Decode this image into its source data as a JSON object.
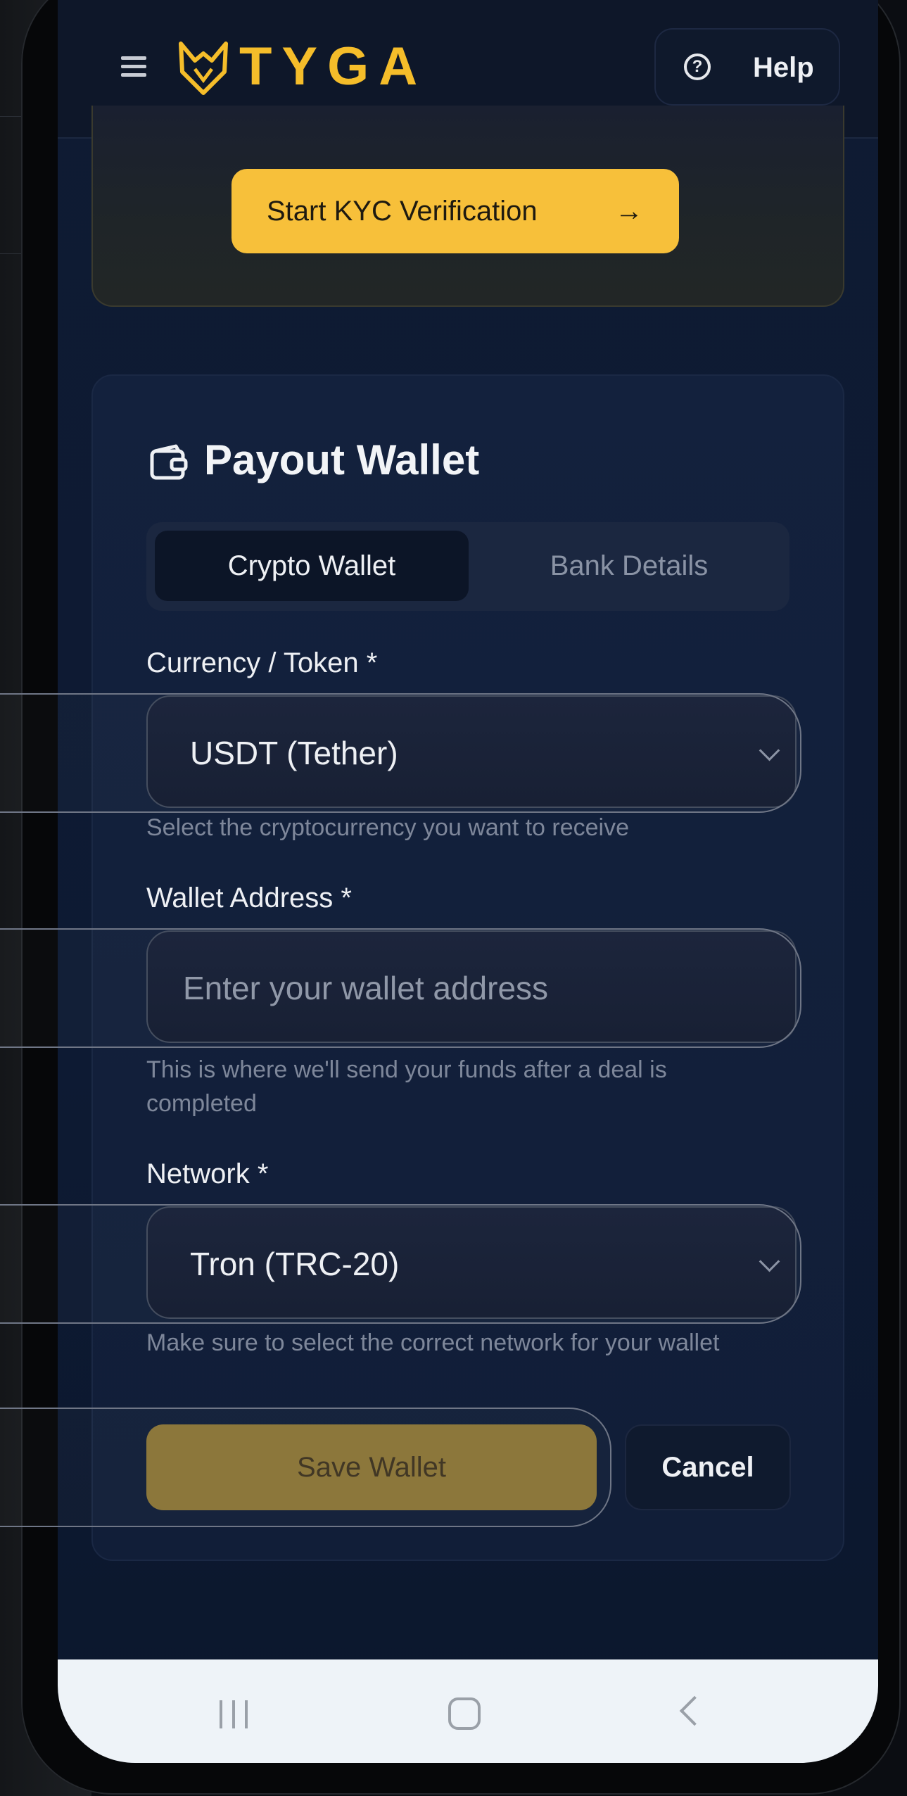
{
  "header": {
    "brand": "TYGA",
    "help_label": "Help",
    "menu_icon": "hamburger-menu-icon",
    "help_icon": "question-circle-icon"
  },
  "kyc": {
    "button_label": "Start KYC Verification",
    "button_arrow": "→"
  },
  "payout_wallet": {
    "title": "Payout Wallet",
    "icon": "wallet-icon",
    "tabs": [
      {
        "label": "Crypto Wallet",
        "active": true
      },
      {
        "label": "Bank Details",
        "active": false
      }
    ],
    "currency": {
      "label": "Currency / Token *",
      "value": "USDT (Tether)",
      "hint": "Select the cryptocurrency you want to receive"
    },
    "wallet_address": {
      "label": "Wallet Address *",
      "placeholder": "Enter your wallet address",
      "hint": "This is where we'll send your funds after a deal is completed"
    },
    "network": {
      "label": "Network *",
      "value": "Tron (TRC-20)",
      "hint": "Make sure to select the correct network for your wallet"
    },
    "save_label": "Save Wallet",
    "cancel_label": "Cancel"
  },
  "colors": {
    "accent": "#f7c03a",
    "background": "#0f1b33",
    "save_disabled": "#8a7437"
  }
}
